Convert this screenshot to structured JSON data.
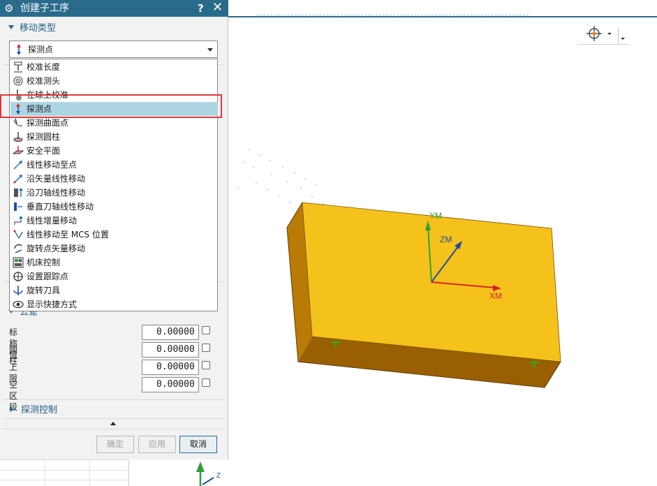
{
  "dialog": {
    "title": "创建子工序",
    "help": "?",
    "close": "✕",
    "motion_section": "移动类型",
    "selected_type": "探测点",
    "dropdown_items": [
      {
        "label": "校准长度",
        "icon": "calibrate-length-icon"
      },
      {
        "label": "校准测头",
        "icon": "calibrate-probe-icon"
      },
      {
        "label": "在球上校准",
        "icon": "calibrate-on-sphere-icon"
      },
      {
        "label": "探测点",
        "icon": "probe-point-icon"
      },
      {
        "label": "探测曲面点",
        "icon": "probe-surface-point-icon"
      },
      {
        "label": "探测圆柱",
        "icon": "probe-cylinder-icon"
      },
      {
        "label": "安全平面",
        "icon": "safe-plane-icon"
      },
      {
        "label": "线性移动至点",
        "icon": "linear-move-to-point-icon"
      },
      {
        "label": "沿矢量线性移动",
        "icon": "linear-move-along-vector-icon"
      },
      {
        "label": "沿刀轴线性移动",
        "icon": "linear-move-along-tool-axis-icon"
      },
      {
        "label": "垂直刀轴线性移动",
        "icon": "linear-move-perpendicular-icon"
      },
      {
        "label": "线性增量移动",
        "icon": "linear-incremental-move-icon"
      },
      {
        "label": "线性移动至 MCS 位置",
        "icon": "linear-move-to-mcs-icon"
      },
      {
        "label": "旋转点矢量移动",
        "icon": "rotate-point-vector-icon"
      },
      {
        "label": "机床控制",
        "icon": "machine-control-icon"
      },
      {
        "label": "设置跟踪点",
        "icon": "tracking-point-icon"
      },
      {
        "label": "旋转刀具",
        "icon": "rotate-tool-icon"
      },
      {
        "label": "显示快捷方式",
        "icon": "show-shortcuts-icon"
      }
    ],
    "selected_index": 3,
    "tolerance_section": "公差",
    "tolerance_rows": [
      {
        "label": "标称值",
        "value": "0.00000"
      },
      {
        "label": "圆柱",
        "value": "0.00000"
      },
      {
        "label": "上限",
        "value": "0.00000"
      },
      {
        "label": "空区段",
        "value": "0.00000"
      }
    ],
    "probe_control_section": "探测控制",
    "buttons": {
      "ok": "确定",
      "apply": "应用",
      "cancel": "取消"
    }
  },
  "viewport": {
    "axis_labels": {
      "x": "XM",
      "y": "YM",
      "z": "ZM"
    },
    "mini_axis_label": "Z",
    "block_color": "#f5c21b",
    "block_side_color": "#b97a06",
    "block_front_color": "#9a5f00",
    "x_axis_color": "#d9232a",
    "y_axis_color": "#2e9e3a",
    "z_axis_color": "#1f4e9c"
  },
  "colors": {
    "title_bar": "#2a6b8c",
    "selection": "#add5e3",
    "highlight": "#e0393e"
  }
}
